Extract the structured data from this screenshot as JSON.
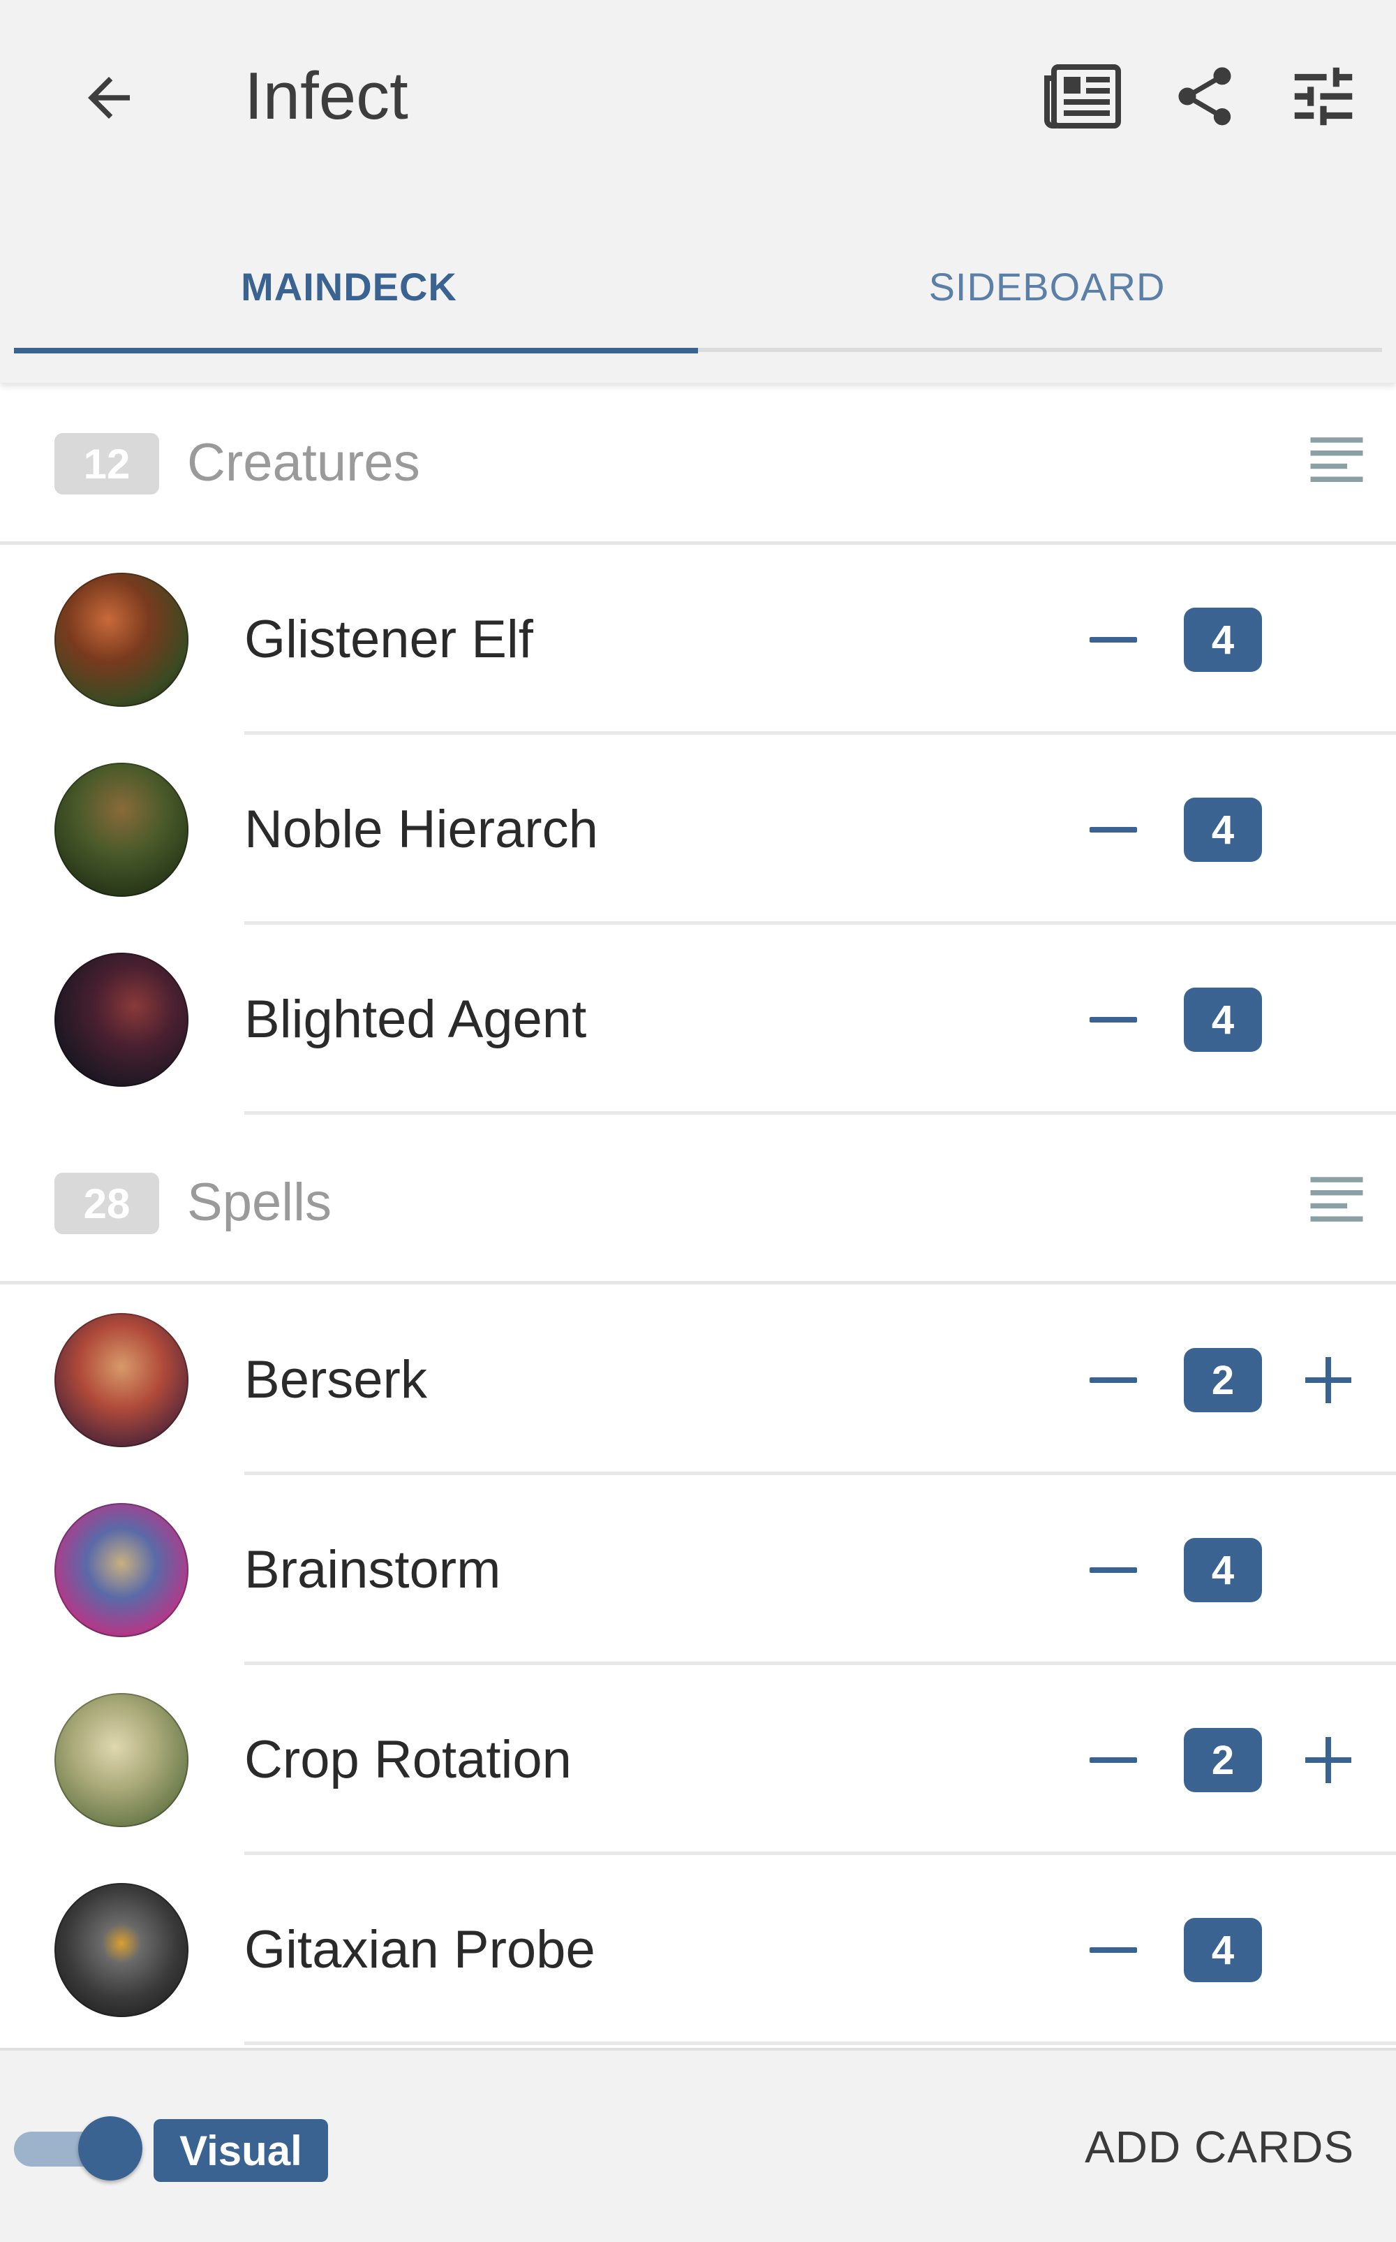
{
  "header": {
    "title": "Infect",
    "icons": [
      "arrow-back-icon",
      "article-view-icon",
      "share-icon",
      "tune-icon"
    ]
  },
  "tabs": [
    {
      "label": "MAINDECK",
      "active": true
    },
    {
      "label": "SIDEBOARD",
      "active": false
    }
  ],
  "sections": [
    {
      "count": "12",
      "title": "Creatures",
      "cards": [
        {
          "name": "Glistener Elf",
          "qty": "4",
          "can_add": false
        },
        {
          "name": "Noble Hierarch",
          "qty": "4",
          "can_add": false
        },
        {
          "name": "Blighted Agent",
          "qty": "4",
          "can_add": false
        }
      ]
    },
    {
      "count": "28",
      "title": "Spells",
      "cards": [
        {
          "name": "Berserk",
          "qty": "2",
          "can_add": true
        },
        {
          "name": "Brainstorm",
          "qty": "4",
          "can_add": false
        },
        {
          "name": "Crop Rotation",
          "qty": "2",
          "can_add": true
        },
        {
          "name": "Gitaxian Probe",
          "qty": "4",
          "can_add": false
        }
      ]
    }
  ],
  "footer": {
    "toggle_on": true,
    "view_label": "Visual",
    "add_cards_label": "ADD CARDS"
  },
  "colors": {
    "accent": "#3a6391",
    "header_bg": "#f2f2f2",
    "badge_grey": "#d9d9d9"
  }
}
